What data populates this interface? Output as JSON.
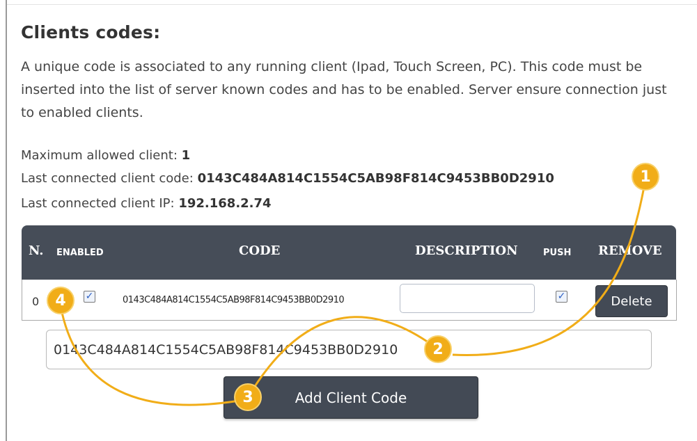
{
  "section": {
    "title": "Clients codes:",
    "description": "A unique code is associated to any running client (Ipad, Touch Screen, PC). This code must be inserted into the list of server known codes and has to be enabled. Server ensure connection just to enabled clients."
  },
  "info": {
    "max_clients_label": "Maximum allowed client:",
    "max_clients_value": "1",
    "last_code_label": "Last connected client code:",
    "last_code_value": "0143C484A814C1554C5AB98F814C9453BB0D2910",
    "last_ip_label": "Last connected client IP:",
    "last_ip_value": "192.168.2.74"
  },
  "table": {
    "headers": {
      "n": "N.",
      "enabled": "ENABLED",
      "code": "CODE",
      "description": "DESCRIPTION",
      "push": "PUSH",
      "remove": "REMOVE"
    },
    "rows": [
      {
        "n": "0",
        "enabled": true,
        "code": "0143C484A814C1554C5AB98F814C9453BB0D2910",
        "description": "",
        "push": true,
        "remove_label": "Delete"
      }
    ]
  },
  "form": {
    "code_value": "0143C484A814C1554C5AB98F814C9453BB0D2910",
    "add_button_label": "Add Client Code"
  },
  "markers": [
    "1",
    "2",
    "3",
    "4"
  ],
  "colors": {
    "header_bg": "#464d58",
    "button_bg": "#434a55",
    "marker": "#f1ad18",
    "checkbox_check": "#2c5fc4"
  }
}
